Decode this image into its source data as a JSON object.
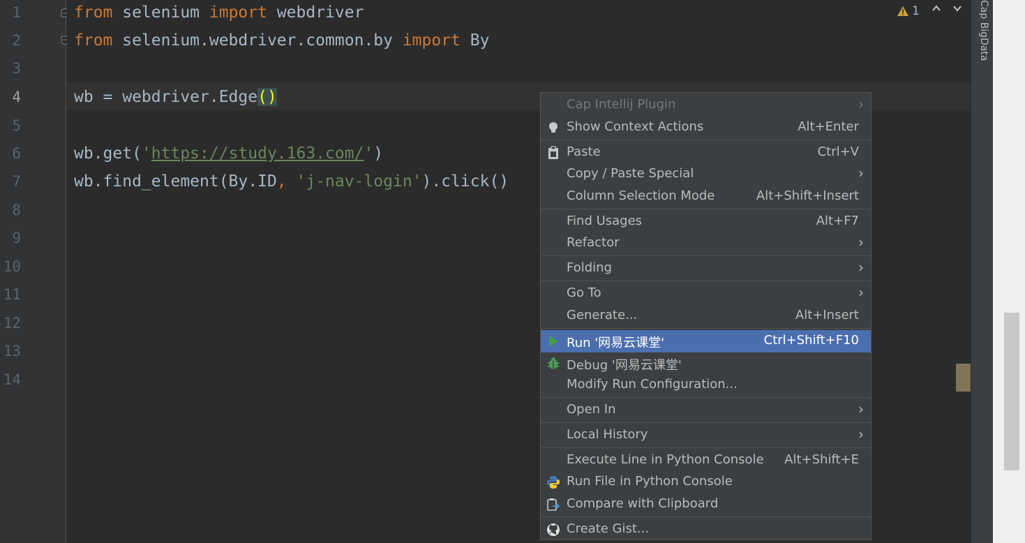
{
  "editor": {
    "line_numbers": [
      "1",
      "2",
      "3",
      "4",
      "5",
      "6",
      "7",
      "8",
      "9",
      "10",
      "11",
      "12",
      "13",
      "14"
    ],
    "lines": {
      "l1": {
        "kw1": "from",
        "t1": " selenium ",
        "kw2": "import",
        "t2": " webdriver"
      },
      "l2": {
        "kw1": "from",
        "t1": " selenium.webdriver.common.by ",
        "kw2": "import",
        "t2": " By"
      },
      "l4": {
        "t1": "wb = webdriver.Edge",
        "paren": "()"
      },
      "l6": {
        "t1": "wb.get(",
        "q1": "'",
        "url": "https://study.163.com/",
        "q2": "'",
        "t2": ")"
      },
      "l7": {
        "t1": "wb.find_element(By.ID",
        "kw": ",",
        "sp": " ",
        "str": "'j-nav-login'",
        "t2": ").click()"
      }
    },
    "inspection": {
      "count": "1",
      "icon": "warning-icon"
    }
  },
  "right_tool_window": {
    "label": "Cap BigData"
  },
  "context_menu": {
    "items": [
      {
        "label": "Cap Intellij Plugin",
        "shortcut": "",
        "submenu": true,
        "disabled": true
      },
      {
        "label": "Show Context Actions",
        "shortcut": "Alt+Enter",
        "icon": "lightbulb-icon"
      },
      {
        "label": "Paste",
        "shortcut": "Ctrl+V",
        "icon": "clipboard-icon"
      },
      {
        "label": "Copy / Paste Special",
        "shortcut": "",
        "submenu": true
      },
      {
        "label": "Column Selection Mode",
        "shortcut": "Alt+Shift+Insert"
      },
      {
        "label": "Find Usages",
        "shortcut": "Alt+F7"
      },
      {
        "label": "Refactor",
        "shortcut": "",
        "submenu": true
      },
      {
        "label": "Folding",
        "shortcut": "",
        "submenu": true
      },
      {
        "label": "Go To",
        "shortcut": "",
        "submenu": true
      },
      {
        "label": "Generate...",
        "shortcut": "Alt+Insert"
      },
      {
        "label": "Run '网易云课堂'",
        "shortcut": "Ctrl+Shift+F10",
        "icon": "run-icon",
        "selected": true
      },
      {
        "label": "Debug '网易云课堂'",
        "shortcut": "",
        "icon": "debug-icon"
      },
      {
        "label": "Modify Run Configuration...",
        "shortcut": ""
      },
      {
        "label": "Open In",
        "shortcut": "",
        "submenu": true
      },
      {
        "label": "Local History",
        "shortcut": "",
        "submenu": true
      },
      {
        "label": "Execute Line in Python Console",
        "shortcut": "Alt+Shift+E"
      },
      {
        "label": "Run File in Python Console",
        "shortcut": "",
        "icon": "python-icon"
      },
      {
        "label": "Compare with Clipboard",
        "shortcut": "",
        "icon": "compare-clipboard-icon"
      },
      {
        "label": "Create Gist...",
        "shortcut": "",
        "icon": "github-icon"
      }
    ]
  }
}
